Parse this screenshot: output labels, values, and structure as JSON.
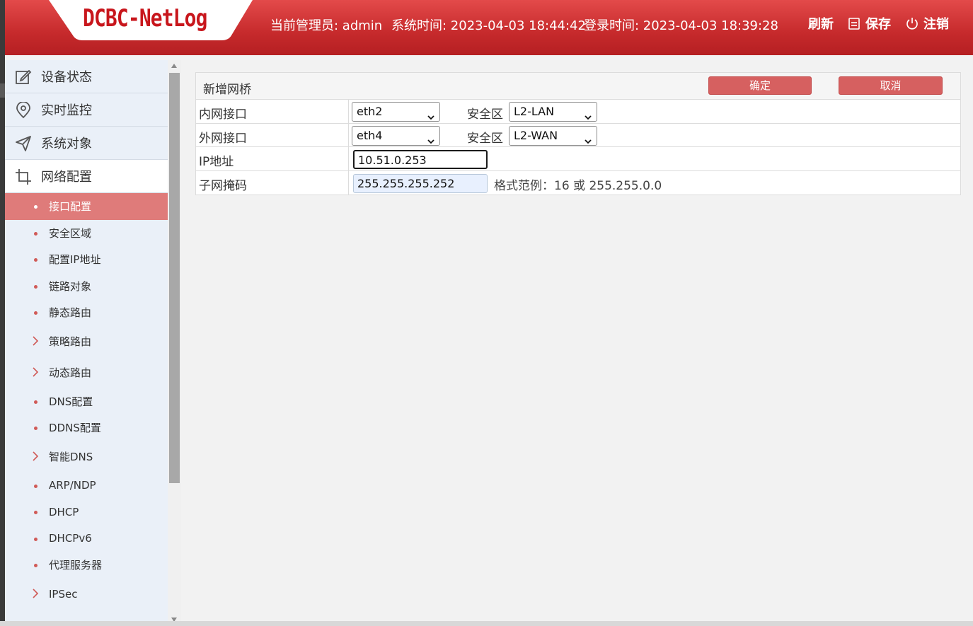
{
  "header": {
    "logo": "DCBC-NetLog",
    "admin": "当前管理员: admin",
    "system_time": "系统时间: 2023-04-03 18:44:42",
    "login_time": "登录时间: 2023-04-03 18:39:28",
    "refresh_label": "刷新",
    "save_label": "保存",
    "logout_label": "注销"
  },
  "sidebar": {
    "top_items": [
      {
        "label": "设备状态",
        "icon": "edit-icon"
      },
      {
        "label": "实时监控",
        "icon": "location-icon"
      },
      {
        "label": "系统对象",
        "icon": "send-icon"
      },
      {
        "label": "网络配置",
        "icon": "crop-icon"
      }
    ],
    "sub_items": [
      {
        "label": "接口配置",
        "type": "dot",
        "active": true
      },
      {
        "label": "安全区域",
        "type": "dot"
      },
      {
        "label": "配置IP地址",
        "type": "dot"
      },
      {
        "label": "链路对象",
        "type": "dot"
      },
      {
        "label": "静态路由",
        "type": "dot"
      },
      {
        "label": "策略路由",
        "type": "chevron"
      },
      {
        "label": "动态路由",
        "type": "chevron"
      },
      {
        "label": "DNS配置",
        "type": "dot"
      },
      {
        "label": "DDNS配置",
        "type": "dot"
      },
      {
        "label": "智能DNS",
        "type": "chevron"
      },
      {
        "label": "ARP/NDP",
        "type": "dot"
      },
      {
        "label": "DHCP",
        "type": "dot"
      },
      {
        "label": "DHCPv6",
        "type": "dot"
      },
      {
        "label": "代理服务器",
        "type": "dot"
      },
      {
        "label": "IPSec",
        "type": "chevron"
      }
    ]
  },
  "form": {
    "title": "新增网桥",
    "confirm_label": "确定",
    "cancel_label": "取消",
    "inner_label": "内网接口",
    "inner_value": "eth2",
    "inner_zone_label": "安全区",
    "inner_zone_value": "L2-LAN",
    "outer_label": "外网接口",
    "outer_value": "eth4",
    "outer_zone_label": "安全区",
    "outer_zone_value": "L2-WAN",
    "ip_label": "IP地址",
    "ip_value": "10.51.0.253",
    "mask_label": "子网掩码",
    "mask_value": "255.255.255.252",
    "mask_hint": "格式范例：16 或 255.255.0.0"
  },
  "colors": {
    "header_red": "#c62a2c",
    "logo_red": "#c8161c",
    "accent": "#d66060",
    "active_nav": "#df7b7a"
  }
}
